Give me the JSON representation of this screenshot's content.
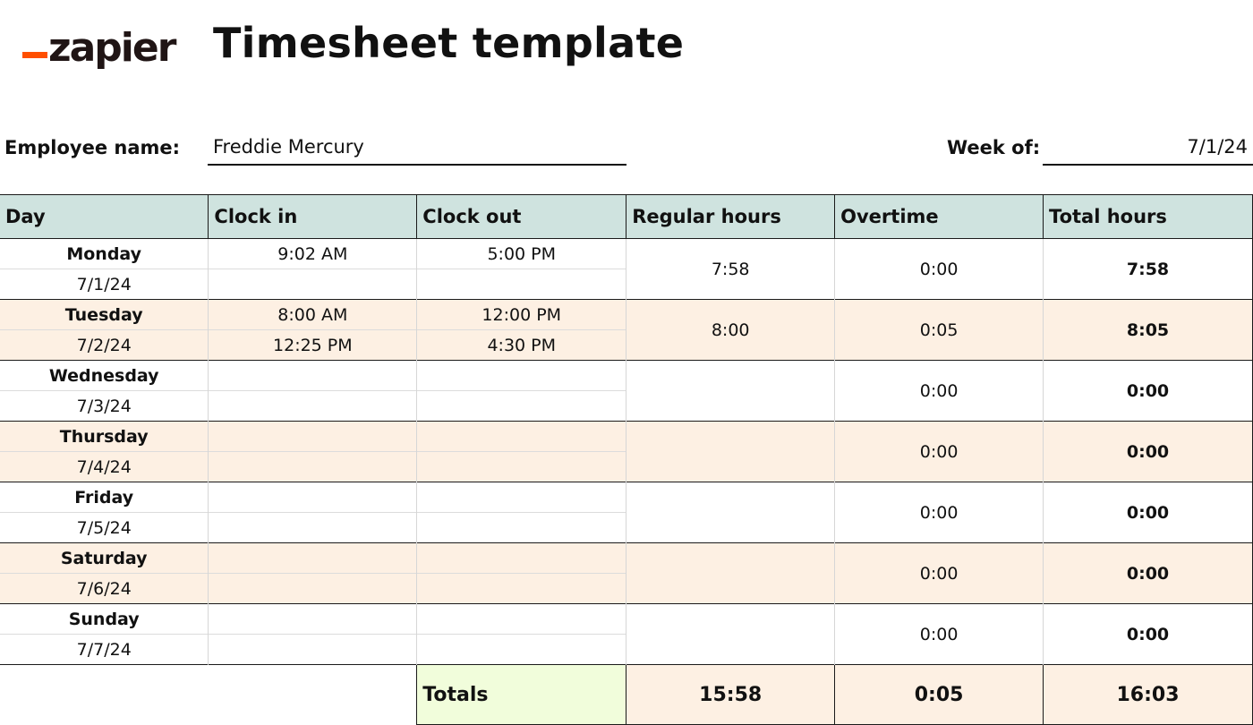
{
  "logo": {
    "text": "zapier"
  },
  "title": "Timesheet template",
  "employee": {
    "label": "Employee name:",
    "value": "Freddie Mercury"
  },
  "week": {
    "label": "Week of:",
    "value": "7/1/24"
  },
  "columns": [
    "Day",
    "Clock in",
    "Clock out",
    "Regular hours",
    "Overtime",
    "Total hours"
  ],
  "days": [
    {
      "day": "Monday",
      "date": "7/1/24",
      "in1": "9:02 AM",
      "out1": "5:00 PM",
      "in2": "",
      "out2": "",
      "regular": "7:58",
      "overtime": "0:00",
      "total": "7:58"
    },
    {
      "day": "Tuesday",
      "date": "7/2/24",
      "in1": "8:00 AM",
      "out1": "12:00 PM",
      "in2": "12:25 PM",
      "out2": "4:30 PM",
      "regular": "8:00",
      "overtime": "0:05",
      "total": "8:05"
    },
    {
      "day": "Wednesday",
      "date": "7/3/24",
      "in1": "",
      "out1": "",
      "in2": "",
      "out2": "",
      "regular": "",
      "overtime": "0:00",
      "total": "0:00"
    },
    {
      "day": "Thursday",
      "date": "7/4/24",
      "in1": "",
      "out1": "",
      "in2": "",
      "out2": "",
      "regular": "",
      "overtime": "0:00",
      "total": "0:00"
    },
    {
      "day": "Friday",
      "date": "7/5/24",
      "in1": "",
      "out1": "",
      "in2": "",
      "out2": "",
      "regular": "",
      "overtime": "0:00",
      "total": "0:00"
    },
    {
      "day": "Saturday",
      "date": "7/6/24",
      "in1": "",
      "out1": "",
      "in2": "",
      "out2": "",
      "regular": "",
      "overtime": "0:00",
      "total": "0:00"
    },
    {
      "day": "Sunday",
      "date": "7/7/24",
      "in1": "",
      "out1": "",
      "in2": "",
      "out2": "",
      "regular": "",
      "overtime": "0:00",
      "total": "0:00"
    }
  ],
  "totals": {
    "label": "Totals",
    "regular": "15:58",
    "overtime": "0:05",
    "total": "16:03"
  },
  "colors": {
    "header_bg": "#cfe3df",
    "shade_bg": "#fdf0e3",
    "totals_label_bg": "#f1fddb",
    "brand": "#ff4f00"
  }
}
